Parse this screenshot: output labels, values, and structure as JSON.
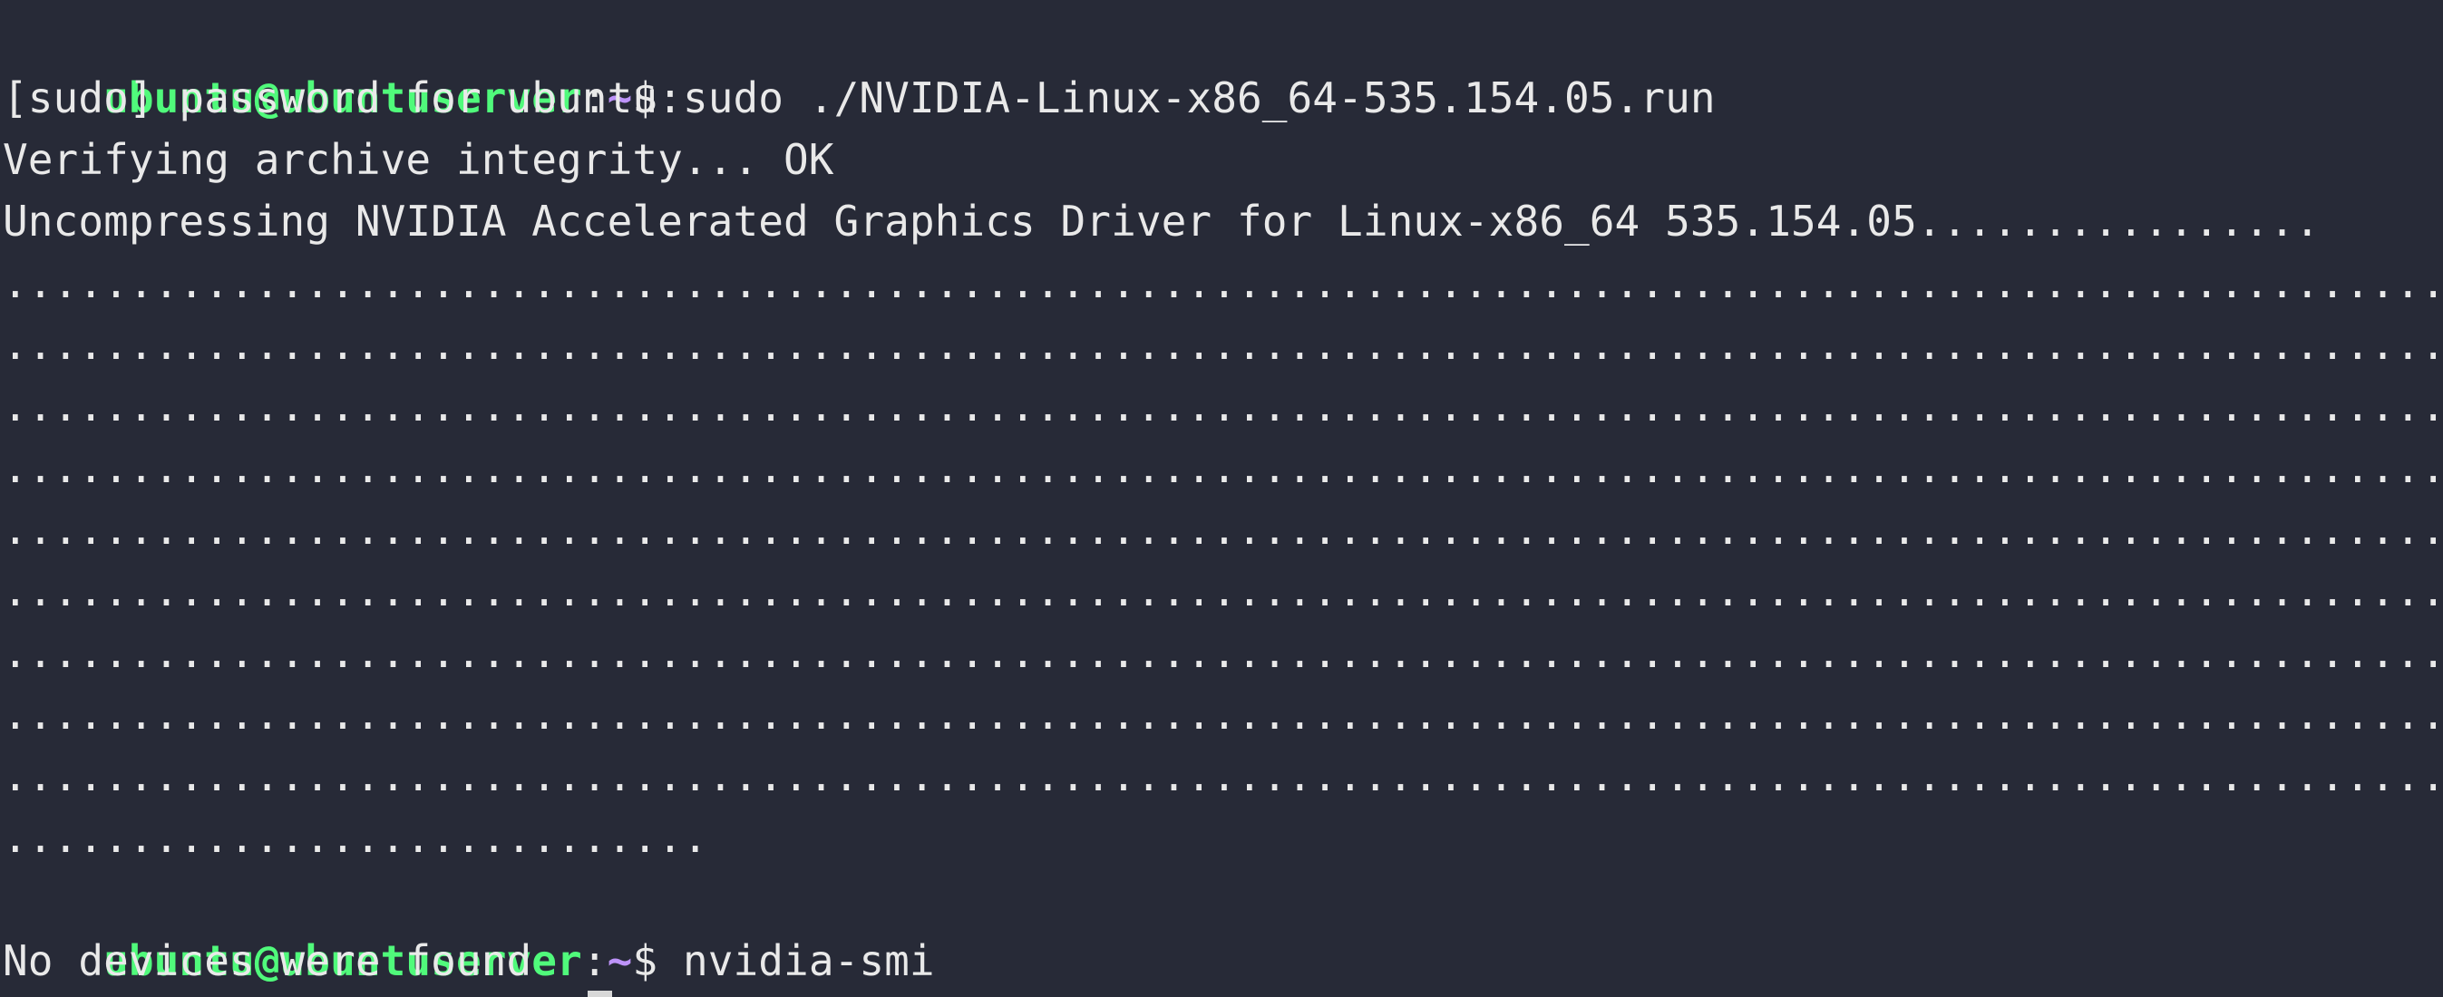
{
  "theme": {
    "background": "#272a37",
    "foreground": "#e9e9e9",
    "prompt_user_color": "#50fa7b",
    "prompt_path_color": "#bd93f9"
  },
  "prompt": {
    "user_host": "ubuntu@ubuntuserver",
    "colon": ":",
    "path": "~",
    "symbol": "$ "
  },
  "lines": [
    {
      "type": "prompt",
      "command": "sudo ./NVIDIA-Linux-x86_64-535.154.05.run"
    },
    {
      "type": "output",
      "text": "[sudo] password for ubuntu:"
    },
    {
      "type": "output",
      "text": "Verifying archive integrity... OK"
    },
    {
      "type": "output",
      "text": "Uncompressing NVIDIA Accelerated Graphics Driver for Linux-x86_64 535.154.05................"
    },
    {
      "type": "output",
      "text": "................................................................................................."
    },
    {
      "type": "output",
      "text": "................................................................................................."
    },
    {
      "type": "output",
      "text": "................................................................................................."
    },
    {
      "type": "output",
      "text": "................................................................................................."
    },
    {
      "type": "output",
      "text": "................................................................................................."
    },
    {
      "type": "output",
      "text": "................................................................................................."
    },
    {
      "type": "output",
      "text": "................................................................................................."
    },
    {
      "type": "output",
      "text": "................................................................................................."
    },
    {
      "type": "output",
      "text": "................................................................................................."
    },
    {
      "type": "output",
      "text": "............................"
    },
    {
      "type": "prompt",
      "command": "nvidia-smi"
    },
    {
      "type": "output",
      "text": "No devices were found"
    }
  ]
}
